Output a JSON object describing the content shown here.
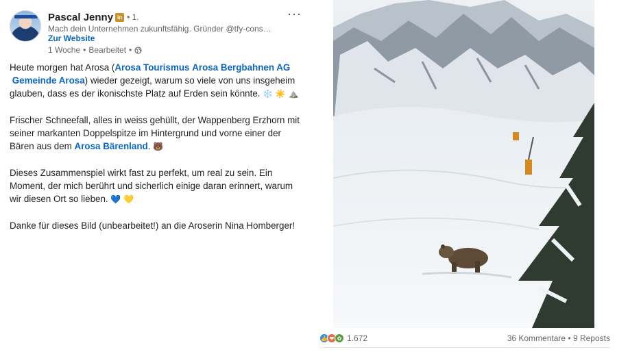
{
  "author": {
    "name": "Pascal Jenny",
    "degree": "• 1.",
    "headline": "Mach dein Unternehmen zukunftsfähig. Gründer @tfy-cons…",
    "website": "Zur Website",
    "time": "1 Woche",
    "edited": "Bearbeitet",
    "separator": "•",
    "badge": "in"
  },
  "menu": {
    "more": "···"
  },
  "body": {
    "p1_a": "Heute morgen hat Arosa (",
    "p1_link1": "Arosa Tourismus",
    "p1_link2": "Arosa Bergbahnen AG",
    "p1_link3": "Gemeinde Arosa",
    "p1_b": ") wieder gezeigt, warum so viele von uns insgeheim glauben, dass es der ikonischste Platz auf Erden sein könnte.",
    "p1_emoji1": "❄️",
    "p1_emoji2": "☀️",
    "p1_emoji3": "⛰️",
    "p2_a": "Frischer Schneefall, alles in weiss gehüllt, der Wappenberg Erzhorn mit seiner markanten Doppelspitze im Hintergrund und vorne einer der Bären aus dem",
    "p2_link": "Arosa Bärenland",
    "p2_b": ".",
    "p2_emoji": "🐻",
    "p3": "Dieses Zusammenspiel wirkt fast zu perfekt, um real zu sein. Ein Moment, der mich berührt und sicherlich einige daran erinnert, warum wir diesen Ort so lieben.",
    "p3_emoji1": "💙",
    "p3_emoji2": "💛",
    "p4": "Danke für dieses Bild (unbearbeitet!) an die Aroserin Nina Homberger!"
  },
  "social": {
    "reactions": "1.672",
    "comments": "36 Kommentare",
    "dot": "•",
    "reposts": "9 Reposts"
  },
  "icons": {
    "like": "like-icon",
    "love": "love-icon",
    "support": "support-icon",
    "globe": "globe-icon"
  }
}
